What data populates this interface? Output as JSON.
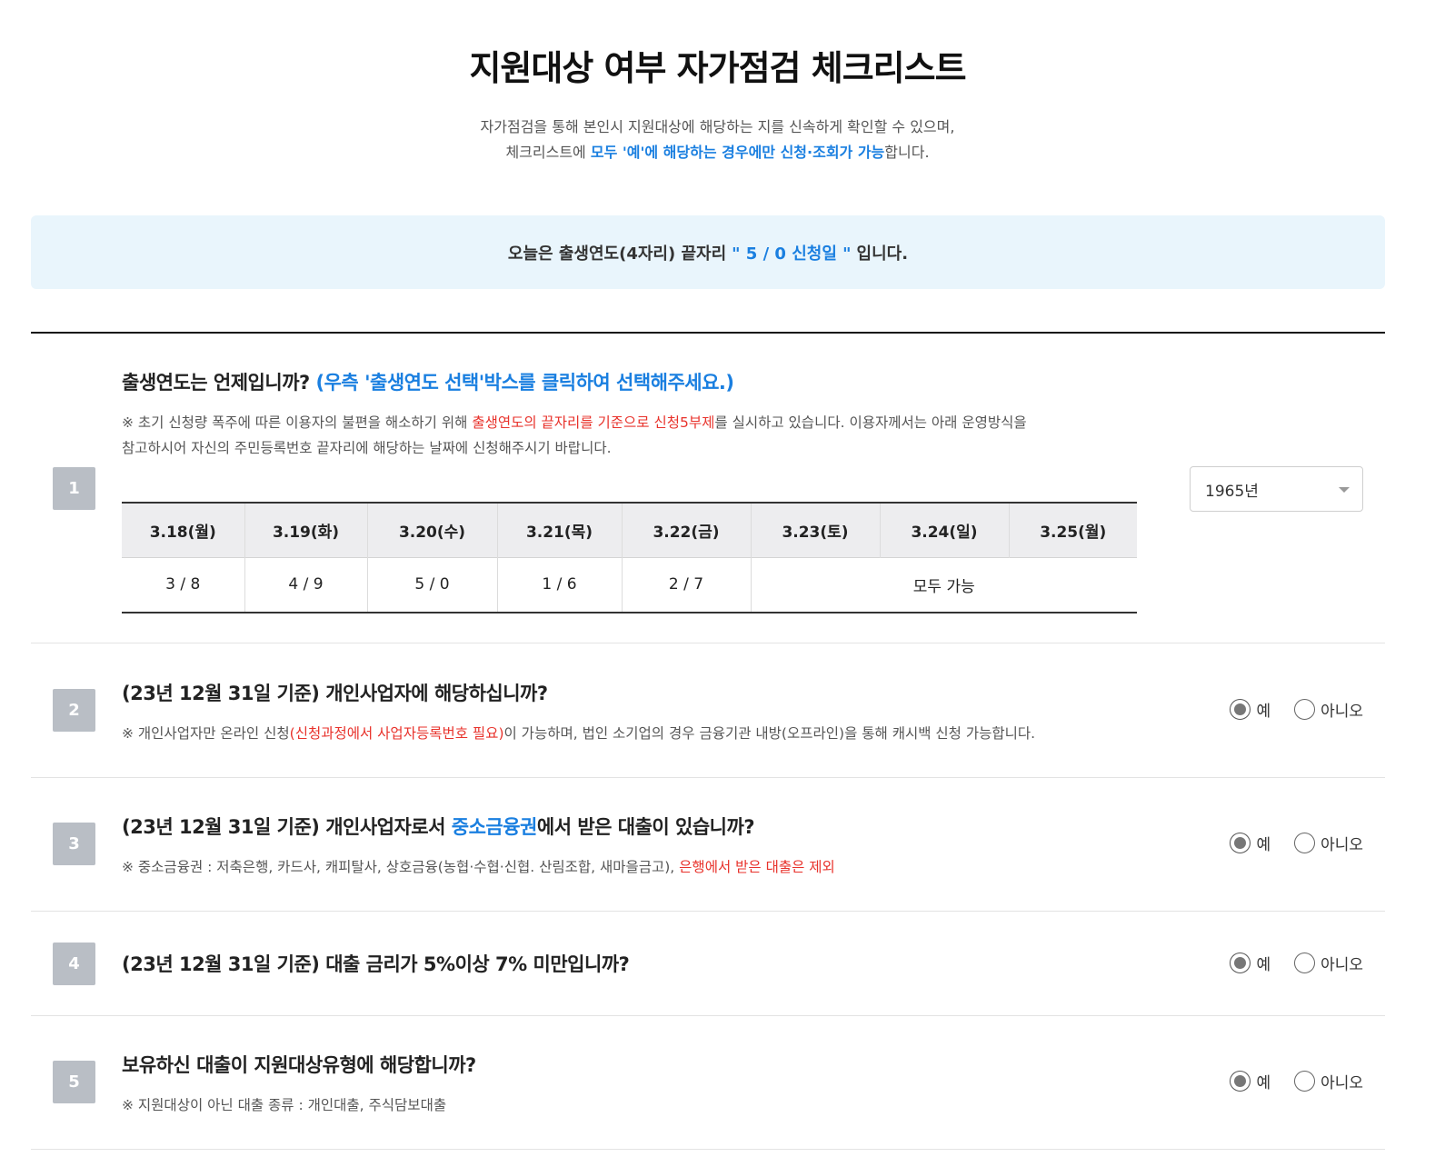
{
  "header": {
    "title": "지원대상 여부 자가점검 체크리스트",
    "intro_line1": "자가점검을 통해 본인시 지원대상에 해당하는 지를 신속하게 확인할 수 있으며,",
    "intro_line2_prefix": "체크리스트에 ",
    "intro_line2_highlight": "모두 '예'에 해당하는 경우에만 신청·조회가 가능",
    "intro_line2_suffix": "합니다."
  },
  "notice": {
    "prefix": "오늘은 출생연도(4자리) 끝자리",
    "highlight": "\" 5 / 0 신청일 \"",
    "suffix": "입니다."
  },
  "questions": [
    {
      "number": "1",
      "text": "출생연도는 언제입니까?",
      "hint": "(우측 '출생연도 선택'박스를 클릭하여 선택해주세요.)",
      "note_prefix": "※  초기 신청량 폭주에 따른 이용자의 불편을 해소하기 위해 ",
      "note_red": "출생연도의 끝자리를 기준으로 신청5부제",
      "note_suffix": "를 실시하고 있습니다. 이용자께서는 아래 운영방식을",
      "note_line2": "참고하시어 자신의 주민등록번호 끝자리에 해당하는 날짜에 신청해주시기 바랍니다.",
      "select_value": "1965년",
      "schedule": {
        "headers": [
          "3.18(월)",
          "3.19(화)",
          "3.20(수)",
          "3.21(목)",
          "3.22(금)",
          "3.23(토)",
          "3.24(일)",
          "3.25(월)"
        ],
        "cells": [
          "3 / 8",
          "4 / 9",
          "5 / 0",
          "1 / 6",
          "2 / 7"
        ],
        "all_label": "모두 가능"
      }
    },
    {
      "number": "2",
      "text": "(23년 12월 31일 기준) 개인사업자에 해당하십니까?",
      "note_prefix": "※ 개인사업자만 온라인 신청",
      "note_red": "(신청과정에서 사업자등록번호 필요)",
      "note_suffix": "이 가능하며, 법인 소기업의 경우 금융기관 내방(오프라인)을 통해 캐시백 신청 가능합니다.",
      "selected": "yes"
    },
    {
      "number": "3",
      "text_prefix": "(23년 12월 31일 기준) 개인사업자로서 ",
      "text_blue": "중소금융권",
      "text_suffix": "에서 받은 대출이 있습니까?",
      "note_prefix": "※ 중소금융권 : 저축은행, 카드사, 캐피탈사, 상호금융(농협·수협·신협. 산림조합, 새마을금고), ",
      "note_red": "은행에서 받은 대출은 제외",
      "selected": "yes"
    },
    {
      "number": "4",
      "text": "(23년 12월 31일 기준) 대출 금리가 5%이상 7% 미만입니까?",
      "selected": "yes"
    },
    {
      "number": "5",
      "text": "보유하신 대출이 지원대상유형에 해당합니까?",
      "note": "※ 지원대상이 아닌 대출 종류 : 개인대출, 주식담보대출",
      "selected": "yes"
    }
  ],
  "options": {
    "yes": "예",
    "no": "아니오"
  },
  "colors": {
    "accent_blue": "#1a7fe0",
    "alert_red": "#e8322b",
    "notice_bg": "#e9f5fc",
    "number_badge": "#b9bec5"
  }
}
